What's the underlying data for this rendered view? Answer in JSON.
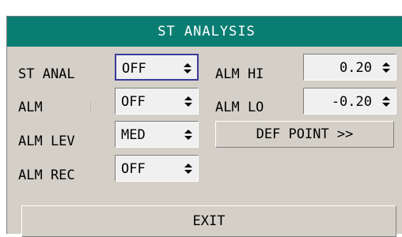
{
  "dialog": {
    "title": "ST ANALYSIS",
    "fields": {
      "st_anal": {
        "label": "ST ANAL",
        "value": "OFF"
      },
      "alm": {
        "label": "ALM",
        "value": "OFF"
      },
      "alm_lev": {
        "label": "ALM LEV",
        "value": "MED"
      },
      "alm_rec": {
        "label": "ALM REC",
        "value": "OFF"
      },
      "alm_hi": {
        "label": "ALM HI",
        "value": "0.20"
      },
      "alm_lo": {
        "label": "ALM LO",
        "value": "-0.20"
      }
    },
    "def_point_label": "DEF POINT >>",
    "exit_label": "EXIT"
  },
  "colors": {
    "title_bar": "#0a7d72",
    "panel_bg": "#d4d0c8",
    "field_bg": "#f0f0f0",
    "focus_border": "#3a3a9a"
  },
  "icons": [
    "spin-arrows-icon"
  ]
}
